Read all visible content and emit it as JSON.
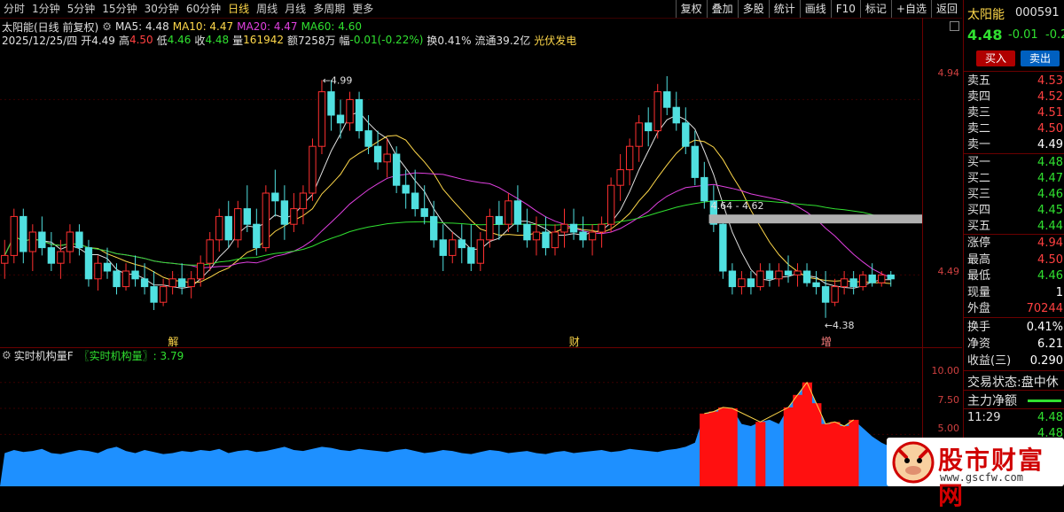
{
  "toolbar": {
    "periods": [
      "分时",
      "1分钟",
      "5分钟",
      "15分钟",
      "30分钟",
      "60分钟",
      "日线",
      "周线",
      "月线",
      "多周期",
      "更多"
    ],
    "active_period": "日线",
    "tools": [
      "复权",
      "叠加",
      "多股",
      "统计",
      "画线",
      "F10",
      "标记",
      "+自选",
      "返回"
    ]
  },
  "info": {
    "title": "太阳能(日线 前复权)",
    "ma5": "MA5: 4.48",
    "ma10": "MA10: 4.47",
    "ma20": "MA20: 4.47",
    "ma60": "MA60: 4.60",
    "date": "2025/12/25/四",
    "open": "开4.49",
    "high_lbl": "高",
    "high": "4.50",
    "low_lbl": "低",
    "low": "4.46",
    "close_lbl": "收",
    "close": "4.48",
    "vol_lbl": "量",
    "vol": "161942",
    "amount": "额7258万",
    "change_lbl": "幅",
    "change": "-0.01(-0.22%)",
    "turnover": "换0.41%",
    "float": "流通39.2亿",
    "sector": "光伏发电"
  },
  "price_axis": {
    "labels": [
      "4.94",
      "4.49"
    ]
  },
  "annotations": {
    "high_mark": "4.99",
    "low_mark": "4.38",
    "range_label": "4.64 - 4.62",
    "events": [
      "解",
      "财",
      "增"
    ]
  },
  "sub_chart": {
    "name": "实时机构量F",
    "indicator": "〖实时机构量〗: 3.79",
    "axis": [
      "10.00",
      "7.50",
      "5.00"
    ]
  },
  "side": {
    "name": "太阳能",
    "code": "000591",
    "price": "4.48",
    "chg": "-0.01",
    "chg_pct": "-0.2",
    "buy_btn": "买入",
    "sell_btn": "卖出",
    "asks": [
      {
        "label": "卖五",
        "val": "4.53"
      },
      {
        "label": "卖四",
        "val": "4.52"
      },
      {
        "label": "卖三",
        "val": "4.51"
      },
      {
        "label": "卖二",
        "val": "4.50"
      },
      {
        "label": "卖一",
        "val": "4.49"
      }
    ],
    "bids": [
      {
        "label": "买一",
        "val": "4.48"
      },
      {
        "label": "买二",
        "val": "4.47"
      },
      {
        "label": "买三",
        "val": "4.46"
      },
      {
        "label": "买四",
        "val": "4.45"
      },
      {
        "label": "买五",
        "val": "4.44"
      }
    ],
    "stats": [
      {
        "label": "涨停",
        "val": "4.94"
      },
      {
        "label": "最高",
        "val": "4.50"
      },
      {
        "label": "最低",
        "val": "4.46"
      },
      {
        "label": "现量",
        "val": "1"
      },
      {
        "label": "外盘",
        "val": "70244"
      }
    ],
    "stats2": [
      {
        "label": "换手",
        "val": "0.41%"
      },
      {
        "label": "净资",
        "val": "6.21"
      },
      {
        "label": "收益(三)",
        "val": "0.290"
      }
    ],
    "status_label": "交易状态:",
    "status_val": "盘中休",
    "netflow_label": "主力净额",
    "time": "11:29",
    "time_price": "4.48",
    "time_price2": "4.48"
  },
  "logo": {
    "text": "股市财富网",
    "url": "www.gscfw.com"
  },
  "chart_data": {
    "type": "candlestick",
    "title": "太阳能(日线 前复权)",
    "ylim": [
      4.3,
      5.05
    ],
    "candles": [
      [
        4.52,
        4.58,
        4.48,
        4.54
      ],
      [
        4.54,
        4.66,
        4.52,
        4.64
      ],
      [
        4.64,
        4.66,
        4.52,
        4.55
      ],
      [
        4.55,
        4.62,
        4.5,
        4.6
      ],
      [
        4.6,
        4.64,
        4.54,
        4.56
      ],
      [
        4.56,
        4.6,
        4.5,
        4.52
      ],
      [
        4.52,
        4.58,
        4.48,
        4.55
      ],
      [
        4.55,
        4.62,
        4.52,
        4.6
      ],
      [
        4.6,
        4.62,
        4.54,
        4.56
      ],
      [
        4.56,
        4.58,
        4.46,
        4.48
      ],
      [
        4.48,
        4.54,
        4.45,
        4.52
      ],
      [
        4.52,
        4.56,
        4.48,
        4.5
      ],
      [
        4.5,
        4.52,
        4.44,
        4.46
      ],
      [
        4.46,
        4.52,
        4.45,
        4.5
      ],
      [
        4.5,
        4.54,
        4.46,
        4.48
      ],
      [
        4.48,
        4.52,
        4.44,
        4.46
      ],
      [
        4.46,
        4.5,
        4.4,
        4.42
      ],
      [
        4.42,
        4.48,
        4.41,
        4.46
      ],
      [
        4.46,
        4.5,
        4.44,
        4.48
      ],
      [
        4.48,
        4.52,
        4.44,
        4.46
      ],
      [
        4.46,
        4.5,
        4.43,
        4.48
      ],
      [
        4.48,
        4.54,
        4.46,
        4.52
      ],
      [
        4.52,
        4.6,
        4.5,
        4.58
      ],
      [
        4.58,
        4.66,
        4.55,
        4.64
      ],
      [
        4.64,
        4.68,
        4.56,
        4.58
      ],
      [
        4.58,
        4.68,
        4.56,
        4.66
      ],
      [
        4.66,
        4.72,
        4.6,
        4.62
      ],
      [
        4.62,
        4.66,
        4.54,
        4.56
      ],
      [
        4.56,
        4.72,
        4.55,
        4.7
      ],
      [
        4.7,
        4.76,
        4.64,
        4.68
      ],
      [
        4.68,
        4.72,
        4.58,
        4.62
      ],
      [
        4.62,
        4.7,
        4.6,
        4.66
      ],
      [
        4.66,
        4.72,
        4.62,
        4.7
      ],
      [
        4.7,
        4.84,
        4.68,
        4.82
      ],
      [
        4.82,
        4.99,
        4.8,
        4.96
      ],
      [
        4.96,
        4.99,
        4.86,
        4.9
      ],
      [
        4.9,
        4.94,
        4.84,
        4.88
      ],
      [
        4.88,
        4.96,
        4.86,
        4.94
      ],
      [
        4.94,
        4.96,
        4.84,
        4.86
      ],
      [
        4.86,
        4.9,
        4.8,
        4.82
      ],
      [
        4.82,
        4.86,
        4.76,
        4.78
      ],
      [
        4.78,
        4.84,
        4.74,
        4.8
      ],
      [
        4.8,
        4.82,
        4.7,
        4.72
      ],
      [
        4.72,
        4.76,
        4.66,
        4.7
      ],
      [
        4.7,
        4.76,
        4.64,
        4.66
      ],
      [
        4.66,
        4.72,
        4.62,
        4.64
      ],
      [
        4.64,
        4.68,
        4.56,
        4.58
      ],
      [
        4.58,
        4.62,
        4.5,
        4.54
      ],
      [
        4.54,
        4.6,
        4.52,
        4.58
      ],
      [
        4.58,
        4.62,
        4.52,
        4.56
      ],
      [
        4.56,
        4.62,
        4.5,
        4.52
      ],
      [
        4.52,
        4.6,
        4.5,
        4.58
      ],
      [
        4.58,
        4.66,
        4.56,
        4.64
      ],
      [
        4.64,
        4.68,
        4.58,
        4.62
      ],
      [
        4.62,
        4.7,
        4.6,
        4.68
      ],
      [
        4.68,
        4.72,
        4.6,
        4.62
      ],
      [
        4.62,
        4.66,
        4.56,
        4.58
      ],
      [
        4.58,
        4.64,
        4.54,
        4.6
      ],
      [
        4.6,
        4.64,
        4.54,
        4.56
      ],
      [
        4.56,
        4.62,
        4.54,
        4.6
      ],
      [
        4.6,
        4.66,
        4.56,
        4.62
      ],
      [
        4.62,
        4.66,
        4.58,
        4.6
      ],
      [
        4.6,
        4.64,
        4.56,
        4.58
      ],
      [
        4.58,
        4.62,
        4.54,
        4.6
      ],
      [
        4.6,
        4.64,
        4.56,
        4.62
      ],
      [
        4.62,
        4.74,
        4.6,
        4.72
      ],
      [
        4.72,
        4.8,
        4.68,
        4.76
      ],
      [
        4.76,
        4.84,
        4.72,
        4.82
      ],
      [
        4.82,
        4.9,
        4.78,
        4.88
      ],
      [
        4.88,
        4.92,
        4.82,
        4.86
      ],
      [
        4.86,
        4.98,
        4.84,
        4.96
      ],
      [
        4.96,
        5.0,
        4.9,
        4.92
      ],
      [
        4.92,
        4.96,
        4.86,
        4.88
      ],
      [
        4.88,
        4.92,
        4.8,
        4.82
      ],
      [
        4.82,
        4.86,
        4.72,
        4.74
      ],
      [
        4.74,
        4.78,
        4.66,
        4.68
      ],
      [
        4.68,
        4.72,
        4.6,
        4.62
      ],
      [
        4.62,
        4.64,
        4.48,
        4.5
      ],
      [
        4.5,
        4.52,
        4.44,
        4.46
      ],
      [
        4.46,
        4.5,
        4.44,
        4.48
      ],
      [
        4.48,
        4.5,
        4.44,
        4.46
      ],
      [
        4.46,
        4.52,
        4.45,
        4.5
      ],
      [
        4.5,
        4.52,
        4.46,
        4.48
      ],
      [
        4.48,
        4.52,
        4.46,
        4.5
      ],
      [
        4.5,
        4.54,
        4.47,
        4.49
      ],
      [
        4.49,
        4.52,
        4.46,
        4.5
      ],
      [
        4.5,
        4.52,
        4.46,
        4.47
      ],
      [
        4.47,
        4.5,
        4.44,
        4.46
      ],
      [
        4.46,
        4.5,
        4.38,
        4.42
      ],
      [
        4.42,
        4.48,
        4.41,
        4.46
      ],
      [
        4.46,
        4.5,
        4.44,
        4.48
      ],
      [
        4.48,
        4.5,
        4.44,
        4.46
      ],
      [
        4.46,
        4.5,
        4.45,
        4.49
      ],
      [
        4.49,
        4.52,
        4.46,
        4.47
      ],
      [
        4.47,
        4.5,
        4.46,
        4.49
      ],
      [
        4.49,
        4.5,
        4.46,
        4.48
      ]
    ],
    "indicator_values": [
      3.2,
      3.5,
      3.3,
      3.4,
      3.6,
      3.2,
      3.1,
      3.3,
      3.5,
      3.4,
      3.2,
      3.6,
      3.8,
      3.4,
      3.2,
      3.5,
      3.3,
      3.1,
      3.2,
      3.4,
      3.3,
      3.5,
      3.4,
      3.6,
      3.2,
      3.4,
      3.5,
      3.3,
      3.4,
      3.6,
      3.8,
      3.5,
      3.4,
      3.6,
      3.8,
      3.7,
      3.5,
      3.4,
      3.6,
      3.5,
      3.4,
      3.3,
      3.5,
      3.6,
      3.4,
      3.2,
      3.3,
      3.5,
      3.4,
      3.2,
      3.1,
      3.3,
      3.5,
      3.4,
      3.2,
      3.3,
      3.4,
      3.2,
      3.1,
      3.3,
      3.4,
      3.2,
      3.3,
      3.4,
      3.5,
      3.3,
      3.4,
      3.6,
      3.5,
      3.4,
      3.3,
      3.5,
      3.6,
      3.8,
      4.2,
      7.0,
      7.2,
      7.6,
      7.5,
      6.0,
      5.8,
      6.2,
      6.4,
      6.0,
      7.6,
      8.8,
      10.0,
      8.0,
      6.0,
      6.2,
      5.8,
      6.4,
      5.6,
      4.8,
      4.2,
      3.79
    ],
    "net_inflow_bars": [
      0,
      0,
      0,
      0,
      0,
      0,
      0,
      0,
      0,
      0,
      0,
      0,
      0,
      0,
      0,
      0,
      0,
      0,
      0,
      0,
      0,
      0,
      0,
      0,
      0,
      0,
      0,
      0,
      0,
      0,
      0,
      0,
      0,
      0,
      0,
      0,
      0,
      0,
      0,
      0,
      0,
      0,
      0,
      0,
      0,
      0,
      0,
      0,
      0,
      0,
      0,
      0,
      0,
      0,
      0,
      0,
      0,
      0,
      0,
      0,
      0,
      0,
      0,
      0,
      0,
      0,
      0,
      0,
      0,
      0,
      0,
      0,
      0,
      0,
      0,
      7.0,
      7.2,
      7.6,
      7.5,
      0,
      0,
      6.2,
      0,
      0,
      7.6,
      8.8,
      10.0,
      8.0,
      6.0,
      6.2,
      5.8,
      6.4,
      0,
      0,
      0,
      0
    ]
  }
}
